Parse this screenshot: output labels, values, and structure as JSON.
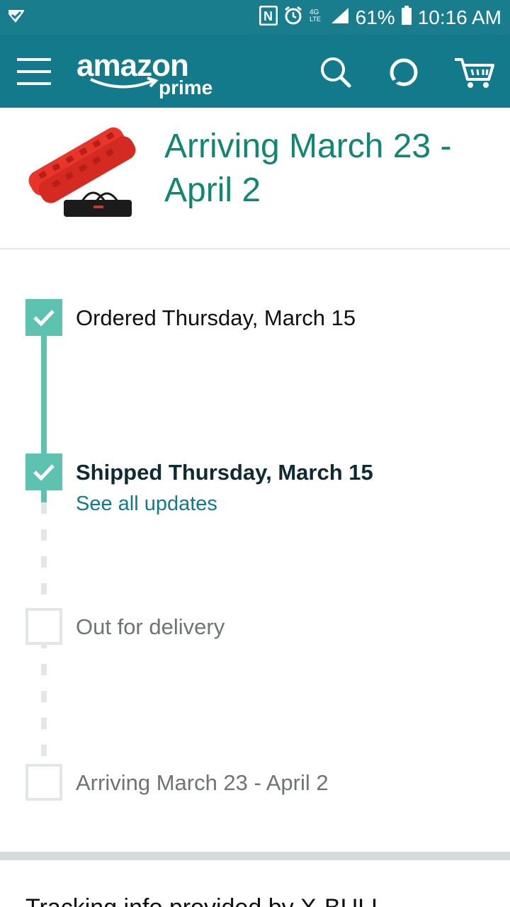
{
  "status_bar": {
    "battery": "61%",
    "time": "10:16 AM",
    "network": "4G LTE"
  },
  "header": {
    "logo_word": "amazon",
    "logo_sub": "prime",
    "icons": [
      "menu-icon",
      "search-icon",
      "alexa-icon",
      "cart-icon"
    ],
    "bar_color": "#127a8a"
  },
  "product": {
    "arrival_title": "Arriving March 23 - April 2",
    "image_icon": "traction-boards-product-image"
  },
  "timeline": {
    "steps": [
      {
        "label": "Ordered Thursday, March 15",
        "state": "done"
      },
      {
        "label": "Shipped Thursday, March 15",
        "state": "done",
        "link": "See all updates"
      },
      {
        "label": "Out for delivery",
        "state": "pending"
      },
      {
        "label": "Arriving March 23 - April 2",
        "state": "pending"
      }
    ],
    "accent": "#5ec2b0"
  },
  "footer": {
    "partial_text": "Tracking info provided by X-BULL"
  }
}
